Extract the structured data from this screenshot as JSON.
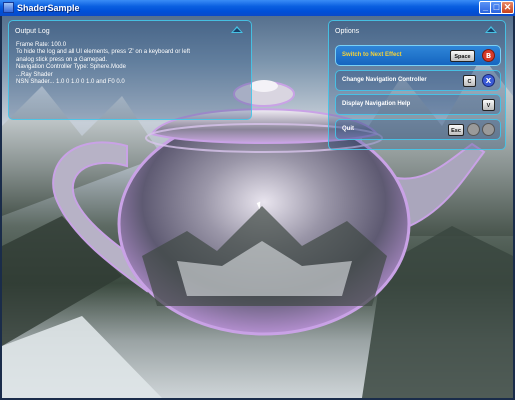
{
  "window": {
    "title": "ShaderSample",
    "minimize_glyph": "_",
    "maximize_glyph": "□",
    "close_glyph": "✕"
  },
  "log_panel": {
    "title": "Output Log",
    "lines": [
      "Frame Rate: 100.0",
      "To hide the log and all UI elements, press 'Z' on a keyboard or left",
      "analog stick press on a Gamepad.",
      "Navigation Controller Type: Sphere.Mode",
      "...Ray Shader",
      "NSN Shader... 1.0 0 1.0 0 1.0 and F0 0.0"
    ]
  },
  "options_panel": {
    "title": "Options",
    "items": [
      {
        "label": "Switch to Next Effect",
        "key": "Space",
        "pad_icon": "gamepad-b-button-icon",
        "pad_color": "#d63a2a",
        "pad_text": "B",
        "selected": true
      },
      {
        "label": "Change Navigation Controller",
        "key": "C",
        "pad_icon": "gamepad-x-button-icon",
        "pad_color": "#3a5ad6",
        "pad_text": "X",
        "selected": false
      },
      {
        "label": "Display Navigation Help",
        "key": "V",
        "pad_icon": "",
        "pad_color": "",
        "pad_text": "",
        "selected": false
      },
      {
        "label": "Quit",
        "key": "Esc",
        "pad_icon": "gamepad-back-buttons-icon",
        "pad_color": "#9a9a9a",
        "pad_text": "",
        "selected": false
      }
    ]
  },
  "colors": {
    "accent": "#46c8eb",
    "selected_label": "#f4d23a",
    "titlebar": "#0a5fe0"
  }
}
